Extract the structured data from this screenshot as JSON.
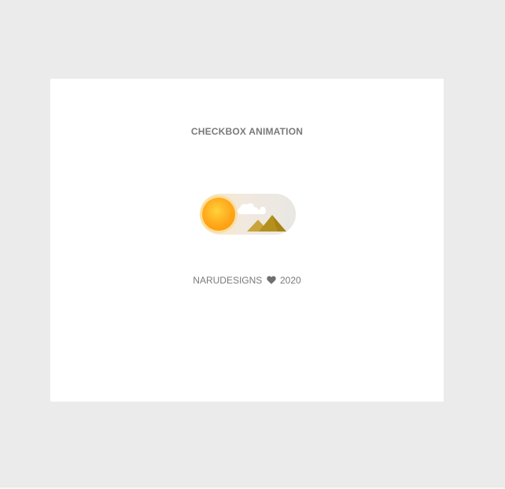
{
  "header": {
    "title": "CHECKBOX ANIMATION"
  },
  "toggle": {
    "checked": false,
    "theme": "day",
    "sun_color": "#ffa41b",
    "track_color": "#ebe7e2"
  },
  "footer": {
    "brand": "NARUDESIGNS",
    "heart_icon": "heart-icon",
    "year": "2020"
  }
}
